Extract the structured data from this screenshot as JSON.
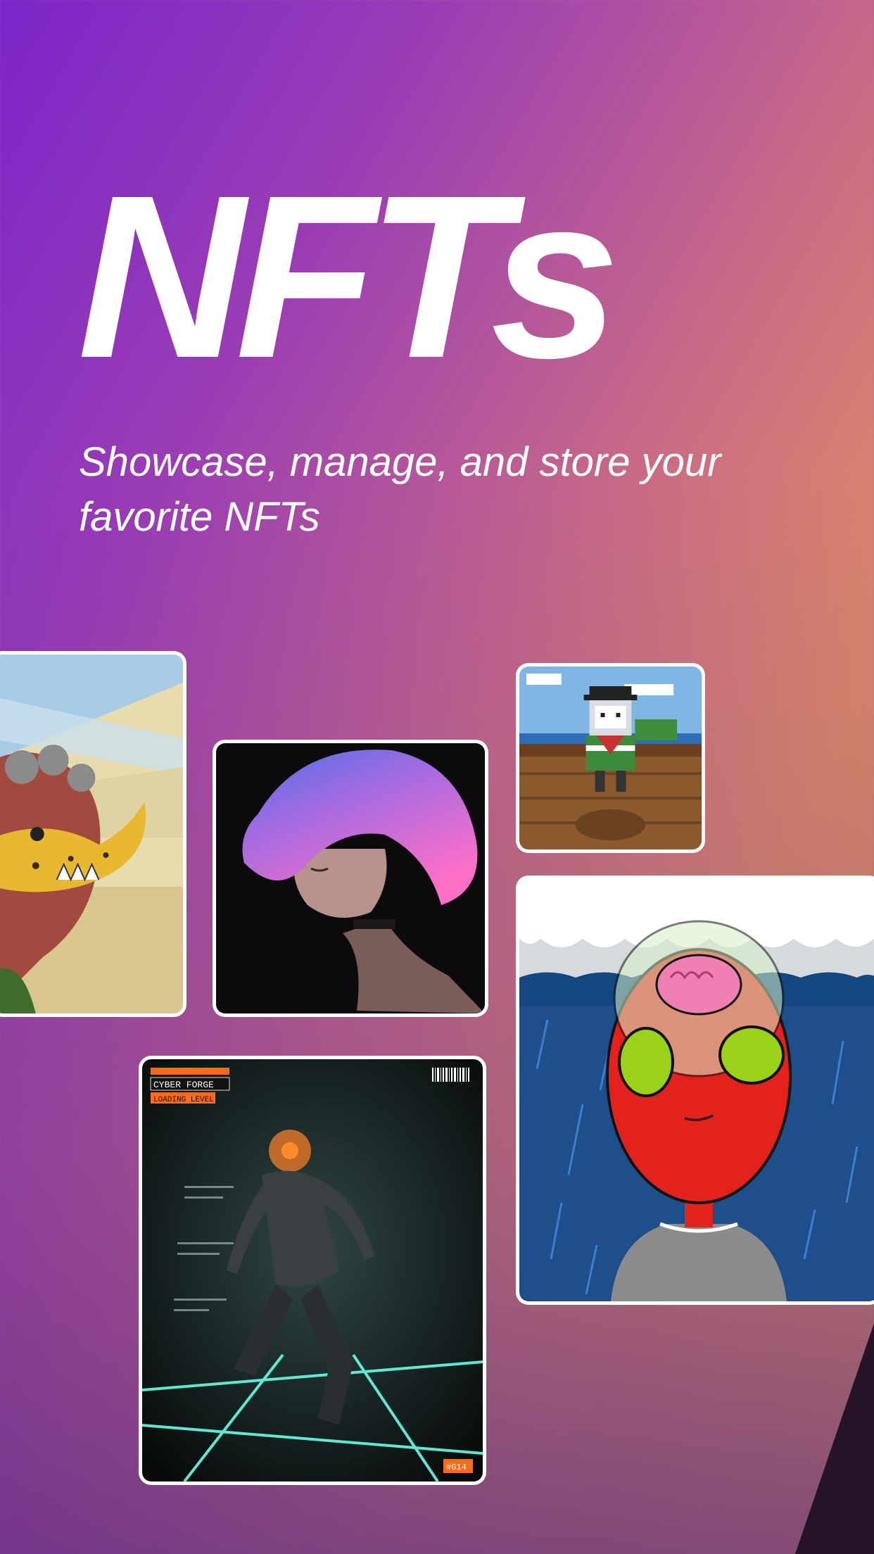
{
  "hero": {
    "title": "NFTs",
    "subtitle": "Showcase, manage, and store your favorite NFTs"
  },
  "cards": [
    {
      "icon": "hand-with-banana-artwork"
    },
    {
      "icon": "anime-girl-portrait-artwork"
    },
    {
      "icon": "pixel-pirate-computer-artwork"
    },
    {
      "icon": "red-alien-brain-artwork"
    },
    {
      "icon": "cyber-racer-artwork",
      "overlay_lines": [
        "CYBER FORGE",
        "LOADING LEVEL"
      ],
      "tag": "#G14"
    }
  ],
  "colors": {
    "gradient_start": "#7a26c9",
    "gradient_end": "#eea04e",
    "text": "#ffffff",
    "card_border": "#ffffff"
  }
}
